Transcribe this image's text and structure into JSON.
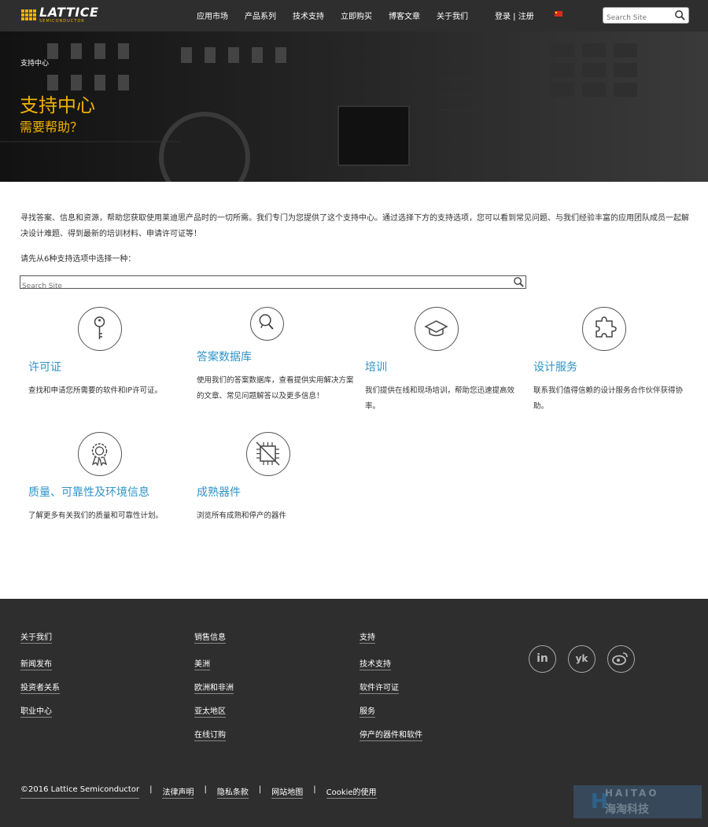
{
  "header": {
    "logo": {
      "name": "LATTICE",
      "tagline": "SEMICONDUCTOR"
    },
    "nav": [
      "应用市场",
      "产品系列",
      "技术支持",
      "立即购买",
      "博客文章",
      "关于我们"
    ],
    "login": "登录 | 注册",
    "search_placeholder": "Search Site"
  },
  "hero": {
    "breadcrumb": "支持中心",
    "title": "支持中心",
    "subtitle": "需要帮助？"
  },
  "main": {
    "intro": "寻找答案、信息和资源，帮助您获取使用莱迪思产品时的一切所需。我们专门为您提供了这个支持中心。通过选择下方的支持选项，您可以看到常见问题、与我们经验丰富的应用团队成员一起解决设计难题、得到最新的培训材料、申请许可证等！",
    "select_prompt": "请先从6种支持选项中选择一种：",
    "search_placeholder": "Search Site",
    "cards": [
      {
        "title": "许可证",
        "desc": "查找和申请您所需要的软件和IP许可证。",
        "icon": "key-icon"
      },
      {
        "title": "答案数据库",
        "desc": "使用我们的答案数据库，查看提供实用解决方案的文章、常见问题解答以及更多信息！",
        "icon": "magnifier-icon"
      },
      {
        "title": "培训",
        "desc": "我们提供在线和现场培训，帮助您迅速提高效率。",
        "icon": "graduation-cap-icon"
      },
      {
        "title": "设计服务",
        "desc": "联系我们值得信赖的设计服务合作伙伴获得协助。",
        "icon": "puzzle-icon"
      },
      {
        "title": "质量、可靠性及环境信息",
        "desc": "了解更多有关我们的质量和可靠性计划。",
        "icon": "award-icon"
      },
      {
        "title": "成熟器件",
        "desc": "浏览所有成熟和停产的器件",
        "icon": "chip-icon"
      }
    ]
  },
  "footer": {
    "col1": [
      "关于我们",
      "新闻发布",
      "投资者关系",
      "职业中心"
    ],
    "col2": [
      "销售信息",
      "美洲",
      "欧洲和非洲",
      "亚太地区",
      "在线订购"
    ],
    "col3": [
      "支持",
      "技术支持",
      "软件许可证",
      "服务",
      "停产的器件和软件"
    ],
    "social": [
      "in",
      "yk",
      "weibo"
    ],
    "legal": [
      "©2016 Lattice Semiconductor",
      "法律声明",
      "隐私条款",
      "网站地图",
      "Cookie的使用"
    ],
    "watermark": {
      "line1": "HAITAO",
      "line2": "海淘科技"
    }
  }
}
